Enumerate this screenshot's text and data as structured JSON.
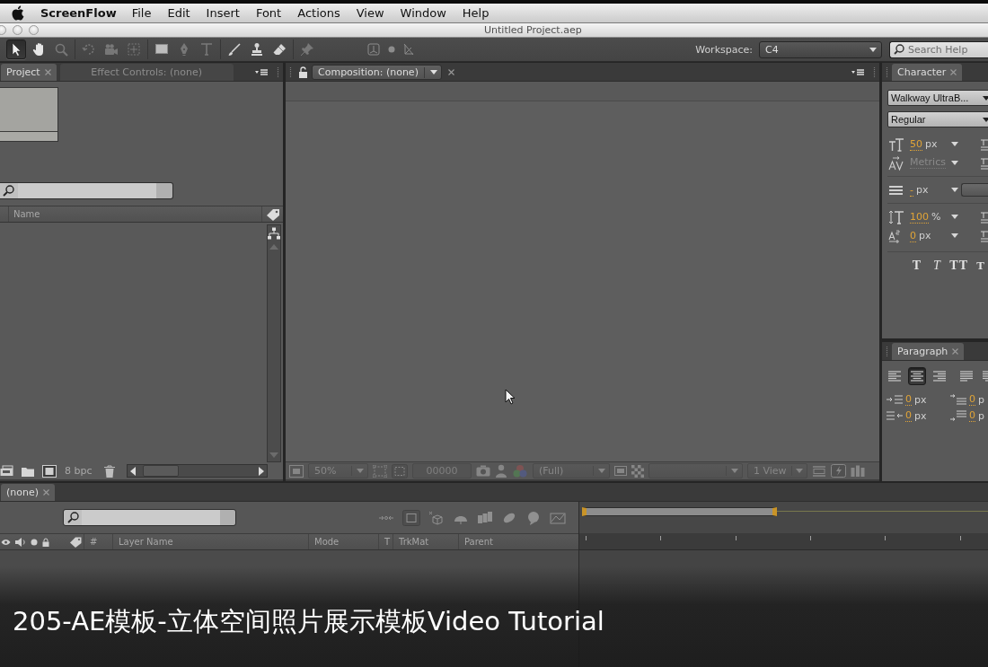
{
  "menu_bar": {
    "app_name": "ScreenFlow",
    "items": [
      "File",
      "Edit",
      "Insert",
      "Font",
      "Actions",
      "View",
      "Window",
      "Help"
    ]
  },
  "window": {
    "title": "Untitled Project.aep"
  },
  "toolbar": {
    "tool_groups": [
      {
        "tools": [
          {
            "kind": "selection",
            "selected": true,
            "disabled": false
          },
          {
            "kind": "hand",
            "selected": false,
            "disabled": false
          },
          {
            "kind": "zoom",
            "selected": false,
            "disabled": true
          }
        ]
      },
      {
        "tools": [
          {
            "kind": "rotate",
            "selected": false,
            "disabled": true
          },
          {
            "kind": "camera",
            "selected": false,
            "disabled": true
          },
          {
            "kind": "pan-behind",
            "selected": false,
            "disabled": true
          }
        ]
      },
      {
        "tools": [
          {
            "kind": "rectangle",
            "selected": false,
            "disabled": false
          },
          {
            "kind": "pen",
            "selected": false,
            "disabled": true
          },
          {
            "kind": "text",
            "selected": false,
            "disabled": true
          }
        ]
      },
      {
        "tools": [
          {
            "kind": "brush",
            "selected": false,
            "disabled": false
          },
          {
            "kind": "clone-stamp",
            "selected": false,
            "disabled": false
          },
          {
            "kind": "eraser",
            "selected": false,
            "disabled": false
          }
        ]
      },
      {
        "tools": [
          {
            "kind": "puppet-pin",
            "selected": false,
            "disabled": true
          }
        ]
      }
    ],
    "workspace": {
      "label": "Workspace:",
      "value": "C4"
    },
    "search_help": {
      "placeholder": "Search Help"
    }
  },
  "project_panel": {
    "tabs": [
      {
        "label": "Project",
        "selected": true
      },
      {
        "label": "Effect Controls: (none)",
        "selected": false
      }
    ],
    "columns": [
      {
        "label": "Name"
      }
    ],
    "bit_depth": "8 bpc"
  },
  "composition_panel": {
    "tab": {
      "label": "Composition: (none)",
      "selected": true
    },
    "footer": {
      "disabled": true,
      "zoom": "50%",
      "timecode": "00000",
      "resolution": "(Full)",
      "view_layout": "1 View"
    }
  },
  "character_panel": {
    "tab": {
      "label": "Character",
      "selected": true
    },
    "font_family": "Walkway UltraB...",
    "font_style": "Regular",
    "groups": [
      {
        "rows": [
          {
            "kind": "font-size",
            "value": "50",
            "unit": "px",
            "disabled": false
          },
          {
            "kind": "kerning",
            "value": "Metrics",
            "disabled": true
          }
        ]
      },
      {
        "rows": [
          {
            "kind": "leading",
            "value": "-",
            "unit": "px",
            "disabled": false
          }
        ]
      },
      {
        "rows": [
          {
            "kind": "vertical-scale",
            "value": "100",
            "unit": "%",
            "disabled": false
          },
          {
            "kind": "baseline-shift",
            "value": "0",
            "unit": "px",
            "disabled": false
          }
        ]
      }
    ],
    "style_buttons": [
      {
        "kind": "bold",
        "label": "T"
      },
      {
        "kind": "italic",
        "label": "T"
      },
      {
        "kind": "all-caps",
        "label": "TT"
      },
      {
        "kind": "small-caps",
        "label": "T"
      }
    ]
  },
  "paragraph_panel": {
    "tab": {
      "label": "Paragraph",
      "selected": true
    },
    "alignment": [
      {
        "kind": "left",
        "selected": false
      },
      {
        "kind": "center",
        "selected": true
      },
      {
        "kind": "right",
        "selected": false
      },
      {
        "kind": "justify-left",
        "selected": false
      },
      {
        "kind": "justify-center",
        "selected": false
      }
    ],
    "spacing": [
      {
        "kind": "indent-left",
        "value": "0",
        "unit": "px"
      },
      {
        "kind": "space-before",
        "value": "0",
        "unit": "p"
      },
      {
        "kind": "indent-right",
        "value": "0",
        "unit": "px"
      },
      {
        "kind": "space-after",
        "value": "0",
        "unit": "p"
      }
    ]
  },
  "timeline": {
    "tab": {
      "label": "(none)",
      "selected": true
    },
    "columns": [
      {
        "label": "#"
      },
      {
        "label": "Layer Name"
      },
      {
        "label": "Mode"
      },
      {
        "label": "T"
      },
      {
        "label": "TrkMat"
      },
      {
        "label": "Parent"
      }
    ],
    "work_area": {
      "level": 0.48
    }
  },
  "caption": {
    "text": "205-AE模板-立体空间照片展示模板Video Tutorial"
  }
}
